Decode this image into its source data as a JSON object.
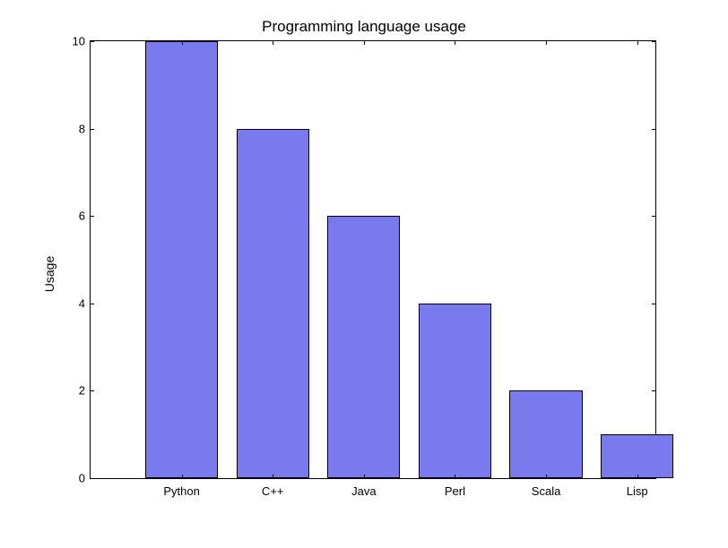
{
  "chart_data": {
    "type": "bar",
    "title": "Programming language usage",
    "ylabel": "Usage",
    "xlabel": "",
    "categories": [
      "Python",
      "C++",
      "Java",
      "Perl",
      "Scala",
      "Lisp"
    ],
    "values": [
      10,
      8,
      6,
      4,
      2,
      1
    ],
    "ylim": [
      0,
      10
    ],
    "yticks": [
      0,
      2,
      4,
      6,
      8,
      10
    ],
    "bar_color": "#7a7aef"
  }
}
